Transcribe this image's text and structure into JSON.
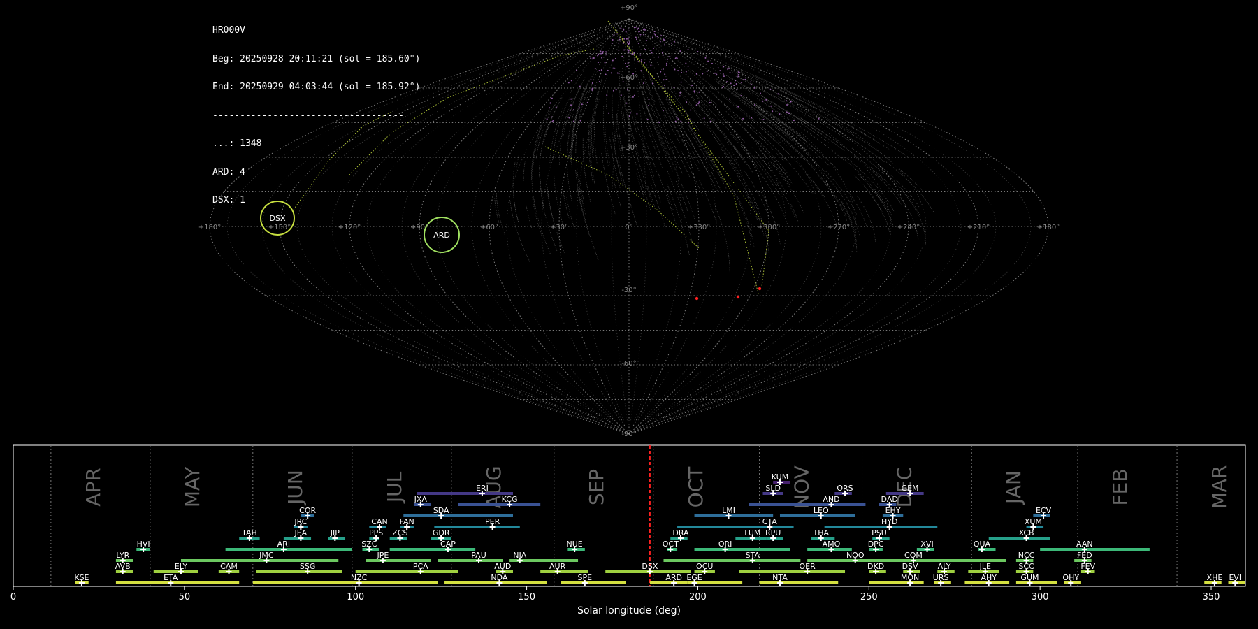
{
  "info": {
    "station": "HR000V",
    "begin": "Beg: 20250928 20:11:21 (sol = 185.60°)",
    "end": "End: 20250929 04:03:44 (sol = 185.92°)",
    "separator": "-----------------------------------",
    "counts": [
      {
        "label": "...",
        "value": "1348"
      },
      {
        "label": "ARD",
        "value": "4"
      },
      {
        "label": "DSX",
        "value": "1"
      }
    ]
  },
  "sky_map": {
    "lon_ticks": [
      "+180°",
      "+150°",
      "+120°",
      "+90°",
      "+60°",
      "+30°",
      "0°",
      "+330°",
      "+300°",
      "+270°",
      "+240°",
      "+210°",
      "+180°"
    ],
    "lat_ticks": [
      "+90°",
      "+60°",
      "+30°",
      "-30°",
      "-60°",
      "-90°"
    ],
    "radiants": [
      {
        "name": "DSX",
        "lon": 150,
        "lat": 0
      },
      {
        "name": "ARD",
        "lon": 80,
        "lat": -3
      }
    ],
    "colors": {
      "grid": "#9a9a9a",
      "sporadic": "#b070c8",
      "radiant": "#c8e040",
      "ard": "#a0e060",
      "highlight": "#ff2020"
    }
  },
  "chart_data": {
    "type": "timeline",
    "xlabel": "Solar longitude (deg)",
    "xlim": [
      0,
      360
    ],
    "xticks": [
      0,
      50,
      100,
      150,
      200,
      250,
      300,
      350
    ],
    "current_sol": 186,
    "months": [
      {
        "name": "APR",
        "start": 11
      },
      {
        "name": "MAY",
        "start": 40
      },
      {
        "name": "JUN",
        "start": 70
      },
      {
        "name": "JUL",
        "start": 99
      },
      {
        "name": "AUG",
        "start": 128
      },
      {
        "name": "SEP",
        "start": 158
      },
      {
        "name": "OCT",
        "start": 187
      },
      {
        "name": "NOV",
        "start": 218
      },
      {
        "name": "DEC",
        "start": 248
      },
      {
        "name": "JAN",
        "start": 280
      },
      {
        "name": "FEB",
        "start": 311
      },
      {
        "name": "MAR",
        "start": 340
      }
    ],
    "showers": [
      {
        "code": "KUM",
        "start": 222,
        "end": 227,
        "peak": 224,
        "row": 8
      },
      {
        "code": "ERI",
        "start": 118,
        "end": 146,
        "peak": 137,
        "row": 7
      },
      {
        "code": "SLD",
        "start": 219,
        "end": 225,
        "peak": 222,
        "row": 7
      },
      {
        "code": "ORS",
        "start": 240,
        "end": 245,
        "peak": 243,
        "row": 7
      },
      {
        "code": "GEM",
        "start": 255,
        "end": 266,
        "peak": 262,
        "row": 7
      },
      {
        "code": "JXA",
        "start": 117,
        "end": 122,
        "peak": 119,
        "row": 6
      },
      {
        "code": "KCG",
        "start": 130,
        "end": 154,
        "peak": 145,
        "row": 6
      },
      {
        "code": "AND",
        "start": 215,
        "end": 249,
        "peak": 239,
        "row": 6
      },
      {
        "code": "DAD",
        "start": 253,
        "end": 258,
        "peak": 256,
        "row": 6
      },
      {
        "code": "COR",
        "start": 84,
        "end": 88,
        "peak": 86,
        "row": 5
      },
      {
        "code": "SDA",
        "start": 114,
        "end": 146,
        "peak": 125,
        "row": 5
      },
      {
        "code": "LMI",
        "start": 199,
        "end": 222,
        "peak": 209,
        "row": 5
      },
      {
        "code": "LEO",
        "start": 224,
        "end": 246,
        "peak": 236,
        "row": 5
      },
      {
        "code": "EHY",
        "start": 254,
        "end": 260,
        "peak": 257,
        "row": 5
      },
      {
        "code": "ECV",
        "start": 298,
        "end": 303,
        "peak": 301,
        "row": 5
      },
      {
        "code": "JRC",
        "start": 82,
        "end": 86,
        "peak": 84,
        "row": 4
      },
      {
        "code": "CAN",
        "start": 104,
        "end": 109,
        "peak": 107,
        "row": 4
      },
      {
        "code": "FAN",
        "start": 113,
        "end": 117,
        "peak": 115,
        "row": 4
      },
      {
        "code": "PER",
        "start": 123,
        "end": 148,
        "peak": 140,
        "row": 4
      },
      {
        "code": "CTA",
        "start": 194,
        "end": 228,
        "peak": 221,
        "row": 4
      },
      {
        "code": "HYD",
        "start": 237,
        "end": 270,
        "peak": 256,
        "row": 4
      },
      {
        "code": "XUM",
        "start": 296,
        "end": 301,
        "peak": 298,
        "row": 4
      },
      {
        "code": "TAH",
        "start": 66,
        "end": 72,
        "peak": 69,
        "row": 3
      },
      {
        "code": "JEA",
        "start": 79,
        "end": 87,
        "peak": 84,
        "row": 3
      },
      {
        "code": "JIP",
        "start": 92,
        "end": 97,
        "peak": 94,
        "row": 3
      },
      {
        "code": "PPS",
        "start": 104,
        "end": 107,
        "peak": 106,
        "row": 3
      },
      {
        "code": "ZCS",
        "start": 110,
        "end": 115,
        "peak": 113,
        "row": 3
      },
      {
        "code": "GDR",
        "start": 122,
        "end": 128,
        "peak": 125,
        "row": 3
      },
      {
        "code": "DRA",
        "start": 192,
        "end": 197,
        "peak": 195,
        "row": 3
      },
      {
        "code": "LUM",
        "start": 211,
        "end": 220,
        "peak": 216,
        "row": 3
      },
      {
        "code": "RPU",
        "start": 220,
        "end": 225,
        "peak": 222,
        "row": 3
      },
      {
        "code": "THA",
        "start": 233,
        "end": 240,
        "peak": 236,
        "row": 3
      },
      {
        "code": "PSU",
        "start": 251,
        "end": 256,
        "peak": 253,
        "row": 3
      },
      {
        "code": "XCB",
        "start": 285,
        "end": 303,
        "peak": 296,
        "row": 3
      },
      {
        "code": "HVI",
        "start": 36,
        "end": 40,
        "peak": 38,
        "row": 2
      },
      {
        "code": "ARI",
        "start": 62,
        "end": 99,
        "peak": 79,
        "row": 2
      },
      {
        "code": "SZC",
        "start": 102,
        "end": 107,
        "peak": 104,
        "row": 2
      },
      {
        "code": "CAP",
        "start": 110,
        "end": 135,
        "peak": 127,
        "row": 2
      },
      {
        "code": "NUE",
        "start": 162,
        "end": 167,
        "peak": 164,
        "row": 2
      },
      {
        "code": "OCT",
        "start": 191,
        "end": 194,
        "peak": 192,
        "row": 2
      },
      {
        "code": "ORI",
        "start": 199,
        "end": 227,
        "peak": 208,
        "row": 2
      },
      {
        "code": "AMO",
        "start": 232,
        "end": 245,
        "peak": 239,
        "row": 2
      },
      {
        "code": "DPC",
        "start": 250,
        "end": 254,
        "peak": 252,
        "row": 2
      },
      {
        "code": "XVI",
        "start": 264,
        "end": 269,
        "peak": 267,
        "row": 2
      },
      {
        "code": "QUA",
        "start": 282,
        "end": 287,
        "peak": 283,
        "row": 2
      },
      {
        "code": "AAN",
        "start": 300,
        "end": 332,
        "peak": 313,
        "row": 2
      },
      {
        "code": "LYR",
        "start": 30,
        "end": 35,
        "peak": 32,
        "row": 1
      },
      {
        "code": "JMC",
        "start": 49,
        "end": 95,
        "peak": 74,
        "row": 1
      },
      {
        "code": "JPE",
        "start": 103,
        "end": 122,
        "peak": 108,
        "row": 1
      },
      {
        "code": "PAU",
        "start": 124,
        "end": 143,
        "peak": 136,
        "row": 1
      },
      {
        "code": "NIA",
        "start": 145,
        "end": 165,
        "peak": 148,
        "row": 1
      },
      {
        "code": "STA",
        "start": 190,
        "end": 230,
        "peak": 216,
        "row": 1
      },
      {
        "code": "NOO",
        "start": 232,
        "end": 250,
        "peak": 246,
        "row": 1
      },
      {
        "code": "COM",
        "start": 250,
        "end": 290,
        "peak": 263,
        "row": 1
      },
      {
        "code": "NCC",
        "start": 293,
        "end": 298,
        "peak": 296,
        "row": 1
      },
      {
        "code": "FED",
        "start": 310,
        "end": 315,
        "peak": 313,
        "row": 1
      },
      {
        "code": "AVB",
        "start": 30,
        "end": 35,
        "peak": 32,
        "row": 0
      },
      {
        "code": "ELY",
        "start": 41,
        "end": 54,
        "peak": 49,
        "row": 0
      },
      {
        "code": "CAM",
        "start": 60,
        "end": 66,
        "peak": 63,
        "row": 0
      },
      {
        "code": "SSG",
        "start": 71,
        "end": 96,
        "peak": 86,
        "row": 0
      },
      {
        "code": "PCA",
        "start": 100,
        "end": 130,
        "peak": 119,
        "row": 0
      },
      {
        "code": "AUD",
        "start": 141,
        "end": 146,
        "peak": 143,
        "row": 0
      },
      {
        "code": "AUR",
        "start": 154,
        "end": 168,
        "peak": 159,
        "row": 0
      },
      {
        "code": "DSX",
        "start": 173,
        "end": 198,
        "peak": 186,
        "row": 0
      },
      {
        "code": "OCU",
        "start": 199,
        "end": 205,
        "peak": 202,
        "row": 0
      },
      {
        "code": "OER",
        "start": 212,
        "end": 243,
        "peak": 232,
        "row": 0
      },
      {
        "code": "DKD",
        "start": 250,
        "end": 255,
        "peak": 252,
        "row": 0
      },
      {
        "code": "DSV",
        "start": 260,
        "end": 265,
        "peak": 262,
        "row": 0
      },
      {
        "code": "ALY",
        "start": 270,
        "end": 275,
        "peak": 272,
        "row": 0
      },
      {
        "code": "JLE",
        "start": 279,
        "end": 288,
        "peak": 284,
        "row": 0
      },
      {
        "code": "SCC",
        "start": 293,
        "end": 298,
        "peak": 296,
        "row": 0
      },
      {
        "code": "FEV",
        "start": 312,
        "end": 316,
        "peak": 314,
        "row": 0
      },
      {
        "code": "KSE",
        "start": 18,
        "end": 22,
        "peak": 20,
        "row": -1
      },
      {
        "code": "ETA",
        "start": 30,
        "end": 66,
        "peak": 46,
        "row": -1
      },
      {
        "code": "NZC",
        "start": 70,
        "end": 124,
        "peak": 101,
        "row": -1
      },
      {
        "code": "NDA",
        "start": 126,
        "end": 156,
        "peak": 142,
        "row": -1
      },
      {
        "code": "SPE",
        "start": 160,
        "end": 179,
        "peak": 167,
        "row": -1
      },
      {
        "code": "ARD",
        "start": 186,
        "end": 197,
        "peak": 193,
        "row": -1
      },
      {
        "code": "EGE",
        "start": 197,
        "end": 213,
        "peak": 199,
        "row": -1
      },
      {
        "code": "NTA",
        "start": 218,
        "end": 241,
        "peak": 224,
        "row": -1
      },
      {
        "code": "MON",
        "start": 250,
        "end": 266,
        "peak": 262,
        "row": -1
      },
      {
        "code": "URS",
        "start": 269,
        "end": 274,
        "peak": 271,
        "row": -1
      },
      {
        "code": "AHY",
        "start": 278,
        "end": 291,
        "peak": 285,
        "row": -1
      },
      {
        "code": "GUM",
        "start": 293,
        "end": 305,
        "peak": 297,
        "row": -1
      },
      {
        "code": "OHY",
        "start": 307,
        "end": 312,
        "peak": 309,
        "row": -1
      },
      {
        "code": "XHE",
        "start": 348,
        "end": 353,
        "peak": 351,
        "row": -1
      },
      {
        "code": "EVI",
        "start": 355,
        "end": 360,
        "peak": 357,
        "row": -1
      }
    ]
  }
}
